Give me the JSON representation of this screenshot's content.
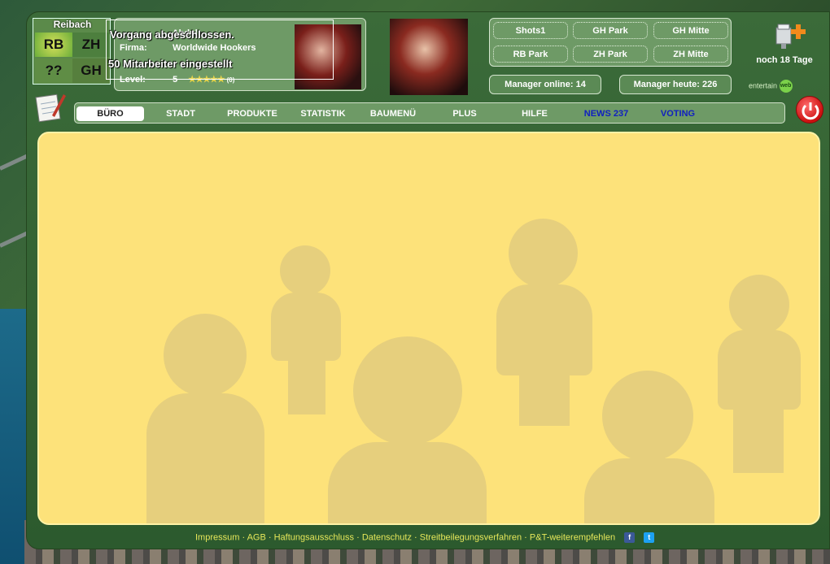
{
  "map": {
    "title": "Reibach",
    "cells": [
      "RB",
      "ZH",
      "??",
      "GH"
    ]
  },
  "info": {
    "rows": [
      {
        "key": "",
        "value": "Abdul"
      },
      {
        "key": "Firma:",
        "value": "Worldwide Hookers"
      },
      {
        "key": "",
        "value": ""
      },
      {
        "key": "Level:",
        "value": "5",
        "stars": "★★★★★",
        "extra": "(0)"
      }
    ]
  },
  "messages": {
    "line1": "Vorgang abgeschlossen.",
    "line2": "50 Mitarbeiter eingestellt"
  },
  "links": [
    "Shots1",
    "GH Park",
    "GH Mitte",
    "RB Park",
    "ZH Park",
    "ZH Mitte"
  ],
  "stats": {
    "online_label": "Manager online:",
    "online_value": "14",
    "today_label": "Manager heute:",
    "today_value": "226"
  },
  "promo": {
    "days": "noch 18 Tage"
  },
  "brand": {
    "label": "entertain",
    "badge": "web"
  },
  "nav": [
    "BÜRO",
    "STADT",
    "PRODUKTE",
    "STATISTIK",
    "BAUMENÜ",
    "PLUS",
    "HILFE",
    "NEWS 237",
    "VOTING"
  ],
  "footer": {
    "links": [
      "Impressum",
      "AGB",
      "Haftungsausschluss",
      "Datenschutz",
      "Streitbeilegungsverfahren",
      "P&T-weiterempfehlen"
    ],
    "sep": " · "
  },
  "social": {
    "facebook": "f",
    "twitter": "t"
  },
  "colors": {
    "panel": "#6e9a66",
    "content": "#fde27a",
    "nav_highlight": "#1020c0",
    "footer_text": "#e6e75a"
  }
}
